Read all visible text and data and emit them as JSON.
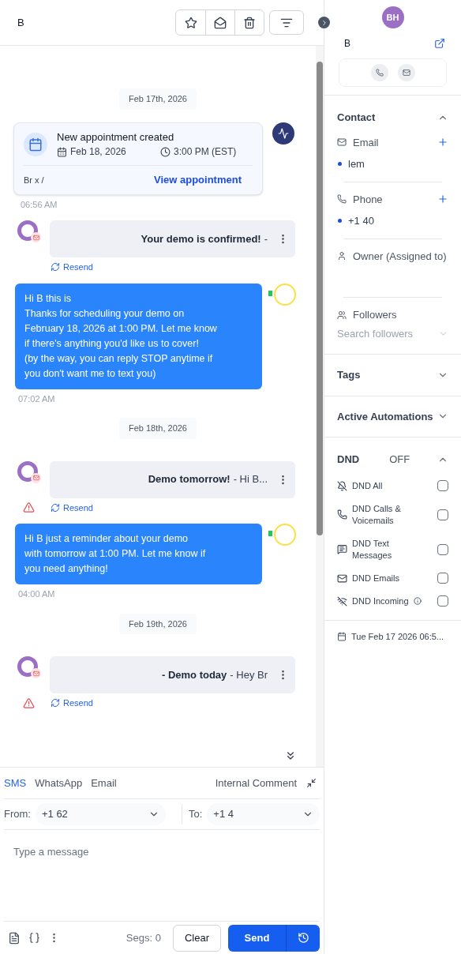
{
  "header": {
    "contact": "B",
    "actions": [
      {
        "kind": "star"
      },
      {
        "kind": "mail"
      },
      {
        "kind": "trash"
      }
    ]
  },
  "thread": [
    {
      "kind": "date",
      "text": "Feb 17th, 2026"
    },
    {
      "kind": "appointment",
      "title": "New appointment created",
      "date": "Feb 18, 2026",
      "time": "3:00 PM (EST)",
      "contact": "Br x /",
      "link": "View appointment",
      "stamp": "06:56 AM"
    },
    {
      "kind": "email",
      "subject": "Your demo is confirmed!",
      "preview": "-",
      "warning": false,
      "resend": "Resend"
    },
    {
      "kind": "sms",
      "text": "Hi B this is\nThanks for scheduling your demo on\nFebruary 18, 2026 at 1:00 PM. Let me know\nif there's anything you'd like us to cover!\n(by the way, you can reply STOP anytime if\nyou don't want me to text you)",
      "stamp": "07:02 AM"
    },
    {
      "kind": "date",
      "text": "Feb 18th, 2026"
    },
    {
      "kind": "email",
      "subject": "Demo tomorrow!",
      "preview": "-  Hi B...",
      "warning": true,
      "resend": "Resend"
    },
    {
      "kind": "sms",
      "text": "Hi B just a reminder about your demo\nwith tomorrow at 1:00 PM. Let me know if\nyou need anything!",
      "stamp": "04:00 AM"
    },
    {
      "kind": "date",
      "text": "Feb 19th, 2026"
    },
    {
      "kind": "email",
      "subject": "- Demo today",
      "preview": "-  Hey Br",
      "warning": true,
      "resend": "Resend"
    }
  ],
  "composer": {
    "channels": [
      {
        "label": "SMS",
        "selected": true
      },
      {
        "label": "WhatsApp",
        "selected": false
      },
      {
        "label": "Email",
        "selected": false
      }
    ],
    "internal": "Internal Comment",
    "from_label": "From:",
    "from": "+1 62",
    "to_label": "To:",
    "to": "+1 4",
    "placeholder": "Type a message",
    "segs": "Segs: 0",
    "clear": "Clear",
    "send": "Send"
  },
  "contact": {
    "initials": "BH",
    "name": "B",
    "sections": [
      {
        "kind": "contact",
        "title": "Contact",
        "expanded": true,
        "email_label": "Email",
        "email": "lem",
        "phone_label": "Phone",
        "phone": "+1 40",
        "owner_label": "Owner (Assigned to)",
        "followers_label": "Followers",
        "followers_placeholder": "Search followers"
      },
      {
        "kind": "plain",
        "title": "Tags",
        "expanded": false
      },
      {
        "kind": "plain",
        "title": "Active Automations",
        "expanded": false
      },
      {
        "kind": "dnd",
        "title": "DND",
        "status": "OFF",
        "expanded": true,
        "items": [
          {
            "label": "DND All",
            "checked": false
          },
          {
            "label": "DND Calls &\nVoicemails",
            "checked": false
          },
          {
            "label": "DND Text\nMessages",
            "checked": false
          },
          {
            "label": "DND Emails",
            "checked": false
          },
          {
            "label": "DND Incoming",
            "checked": false,
            "info": true
          }
        ]
      }
    ],
    "footer": "Tue Feb 17 2026 06:5..."
  }
}
